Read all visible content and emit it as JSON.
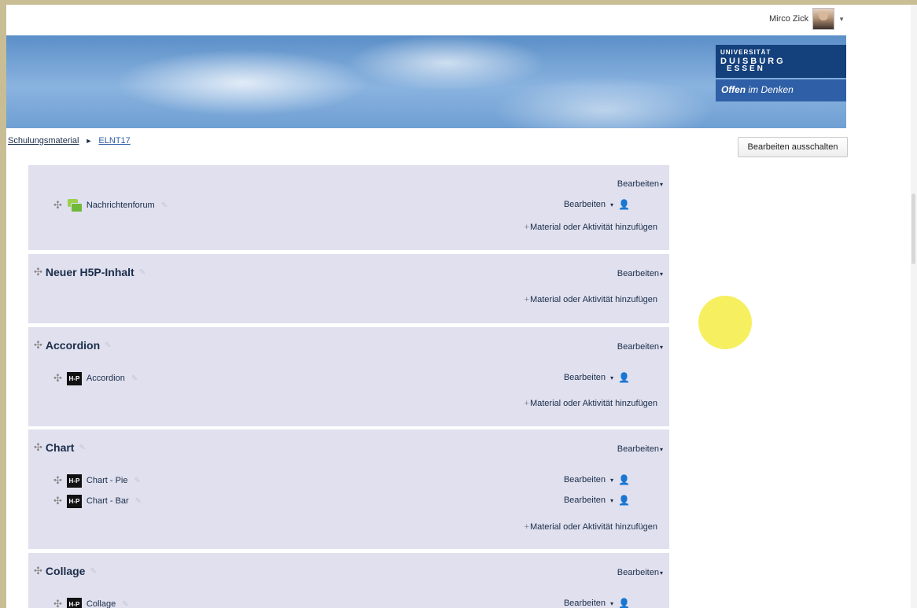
{
  "user": {
    "name": "Mirco Zick"
  },
  "banner": {
    "logo_line1": "UNIVERSITÄT",
    "logo_line2": "DUISBURG",
    "logo_line3": "ESSEN",
    "slogan_bold": "Offen",
    "slogan_rest": "im Denken"
  },
  "breadcrumb": {
    "items": [
      "Schulungsmaterial",
      "ELNT17"
    ]
  },
  "edit_toggle_label": "Bearbeiten ausschalten",
  "labels": {
    "edit": "Bearbeiten",
    "add": "Material oder Aktivität hinzufügen",
    "h5p": "H-P"
  },
  "sections": [
    {
      "title": "",
      "activities": [
        {
          "name": "Nachrichtenforum",
          "type": "forum"
        }
      ]
    },
    {
      "title": "Neuer H5P-Inhalt",
      "activities": []
    },
    {
      "title": "Accordion",
      "activities": [
        {
          "name": "Accordion",
          "type": "h5p"
        }
      ]
    },
    {
      "title": "Chart",
      "activities": [
        {
          "name": "Chart - Pie",
          "type": "h5p"
        },
        {
          "name": "Chart - Bar",
          "type": "h5p"
        }
      ]
    },
    {
      "title": "Collage",
      "activities": [
        {
          "name": "Collage",
          "type": "h5p"
        }
      ]
    }
  ]
}
